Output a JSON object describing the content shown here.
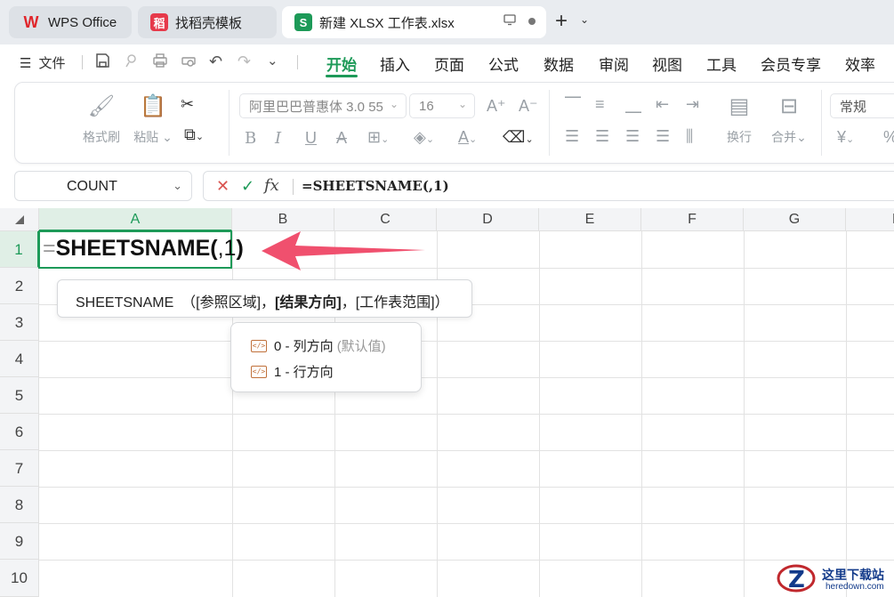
{
  "tabs": {
    "wps": {
      "label": "WPS Office",
      "icon": "wps-logo-icon"
    },
    "template": {
      "label": "找稻壳模板",
      "icon": "docer-icon"
    },
    "active": {
      "label": "新建 XLSX 工作表.xlsx",
      "icon": "spreadsheet-icon",
      "badge": "S"
    }
  },
  "menu": {
    "file_label": "文件",
    "items": [
      "开始",
      "插入",
      "页面",
      "公式",
      "数据",
      "审阅",
      "视图",
      "工具",
      "会员专享",
      "效率"
    ],
    "active_index": 0
  },
  "ribbon": {
    "format_painter": "格式刷",
    "paste": "粘贴",
    "font_name": "阿里巴巴普惠体 3.0 55",
    "font_size": "16",
    "wrap": "换行",
    "merge": "合并",
    "number_format": "常规",
    "currency": "¥",
    "percent": "%"
  },
  "formula_bar": {
    "name_box": "COUNT",
    "fx_label": "fx",
    "formula": "=SHEETSNAME(,1)"
  },
  "grid": {
    "columns": [
      "A",
      "B",
      "C",
      "D",
      "E",
      "F",
      "G",
      "H"
    ],
    "rows": [
      "1",
      "2",
      "3",
      "4",
      "5",
      "6",
      "7",
      "8",
      "9",
      "10"
    ],
    "selected_column": "A",
    "selected_row": "1",
    "active_cell": {
      "equals": "=",
      "func": "SHEETSNAME(",
      "arg": ",1",
      "close": ")"
    }
  },
  "tooltip": {
    "func": "SHEETSNAME",
    "open": "（[参照区域]，",
    "current_arg": "[结果方向]",
    "rest": "，[工作表范围]）"
  },
  "suggestions": [
    {
      "label": "0 - 列方向",
      "hint": "(默认值)"
    },
    {
      "label": "1 - 行方向",
      "hint": ""
    }
  ],
  "watermark": {
    "title": "这里下载站",
    "url": "heredown.com"
  },
  "colors": {
    "accent": "#1d9a58",
    "arrow": "#f0506e",
    "cancel": "#d9534f"
  }
}
